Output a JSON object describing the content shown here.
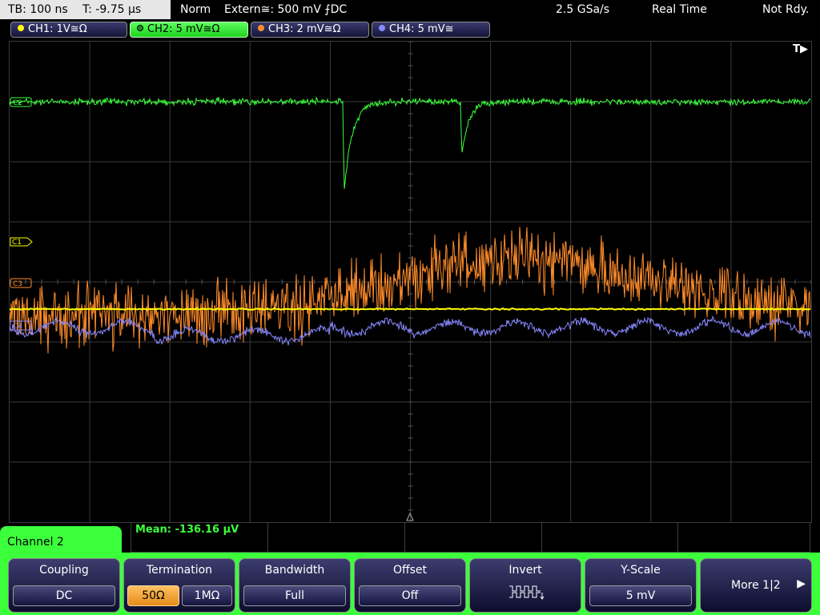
{
  "topbar": {
    "timebase": "TB: 100 ns",
    "trigger_time": "T: -9.75 µs",
    "mode": "Norm",
    "trigger_source": "Extern≅: 500 mV ⨍DC",
    "sample_rate": "2.5 GSa/s",
    "acquisition": "Real Time",
    "status": "Not Rdy."
  },
  "channels": [
    {
      "label": "CH1: 1V≅Ω",
      "color": "#ffff00",
      "active": false
    },
    {
      "label": "CH2: 5 mV≅Ω",
      "color": "#3cff3c",
      "active": true
    },
    {
      "label": "CH3: 2 mV≅Ω",
      "color": "#ff8c2a",
      "active": false
    },
    {
      "label": "CH4: 5 mV≅",
      "color": "#8888ff",
      "active": false
    }
  ],
  "display": {
    "trigger_indicator": "T▶",
    "c1_marker": "C1",
    "c2_marker": "C2",
    "c3_marker": "C3",
    "c4_marker": "C4"
  },
  "measurement": {
    "text": "Mean: -136.16 µV"
  },
  "menu": {
    "title": "Channel 2",
    "coupling": {
      "title": "Coupling",
      "value": "DC"
    },
    "termination": {
      "title": "Termination",
      "option_50": "50Ω",
      "option_1m": "1MΩ",
      "selected": "50Ω"
    },
    "bandwidth": {
      "title": "Bandwidth",
      "value": "Full"
    },
    "offset": {
      "title": "Offset",
      "value": "Off"
    },
    "invert": {
      "title": "Invert"
    },
    "yscale": {
      "title": "Y-Scale",
      "value": "5 mV"
    },
    "more": {
      "label": "More 1|2"
    }
  },
  "colors": {
    "ch1": "#ffff00",
    "ch2": "#3cff3c",
    "ch3": "#ff8c2a",
    "ch4": "#8888ff",
    "grid": "#3a3a3a"
  }
}
